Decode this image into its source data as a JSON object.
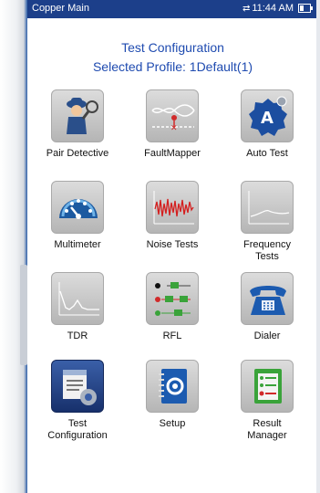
{
  "status_bar": {
    "title": "Copper Main",
    "time": "11:44 AM"
  },
  "header": {
    "line1": "Test Configuration",
    "line2": "Selected Profile:  1Default(1)"
  },
  "tiles": [
    {
      "label": "Pair Detective",
      "icon": "detective-icon"
    },
    {
      "label": "FaultMapper",
      "icon": "fault-mapper-icon"
    },
    {
      "label": "Auto Test",
      "icon": "auto-test-icon"
    },
    {
      "label": "Multimeter",
      "icon": "gauge-icon"
    },
    {
      "label": "Noise Tests",
      "icon": "noise-wave-icon"
    },
    {
      "label": "Frequency\nTests",
      "icon": "frequency-graph-icon"
    },
    {
      "label": "TDR",
      "icon": "tdr-trace-icon"
    },
    {
      "label": "RFL",
      "icon": "rfl-icon"
    },
    {
      "label": "Dialer",
      "icon": "phone-icon"
    },
    {
      "label": "Test\nConfiguration",
      "icon": "config-icon"
    },
    {
      "label": "Setup",
      "icon": "setup-notebook-icon"
    },
    {
      "label": "Result\nManager",
      "icon": "result-manager-icon"
    }
  ]
}
